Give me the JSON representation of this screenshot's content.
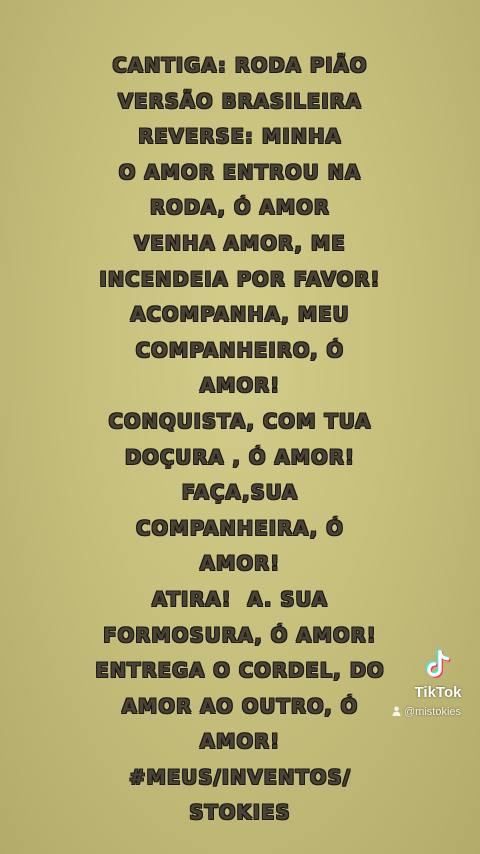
{
  "lyrics": {
    "lines": [
      "CANTIGA: RODA PIÃO",
      "VERSÃO BRASILEIRA",
      "REVERSE: MINHA",
      "O AMOR ENTROU NA",
      "RODA, Ó AMOR",
      "VENHA AMOR, ME",
      "INCENDEIA POR FAVOR!",
      "ACOMPANHA, MEU",
      "COMPANHEIRO, Ó",
      "AMOR!",
      "CONQUISTA, COM TUA",
      "DOÇURA , Ó AMOR!",
      "FAÇA,SUA",
      "COMPANHEIRA, Ó",
      "AMOR!",
      "ATIRA!  A. SUA",
      "FORMOSURA, Ó AMOR!",
      "ENTREGA O CORDEL, DO",
      "AMOR AO OUTRO, Ó",
      "AMOR!",
      "#MEUS/INVENTOS/",
      "STOKIES"
    ]
  },
  "watermark": {
    "brand": "TikTok",
    "handle": "@mistokies",
    "logo_icon": "tiktok-logo-icon",
    "user_icon": "user-icon",
    "colors": {
      "cyan": "#25F4EE",
      "pink": "#FE2C55",
      "white": "#FFFFFF"
    }
  }
}
